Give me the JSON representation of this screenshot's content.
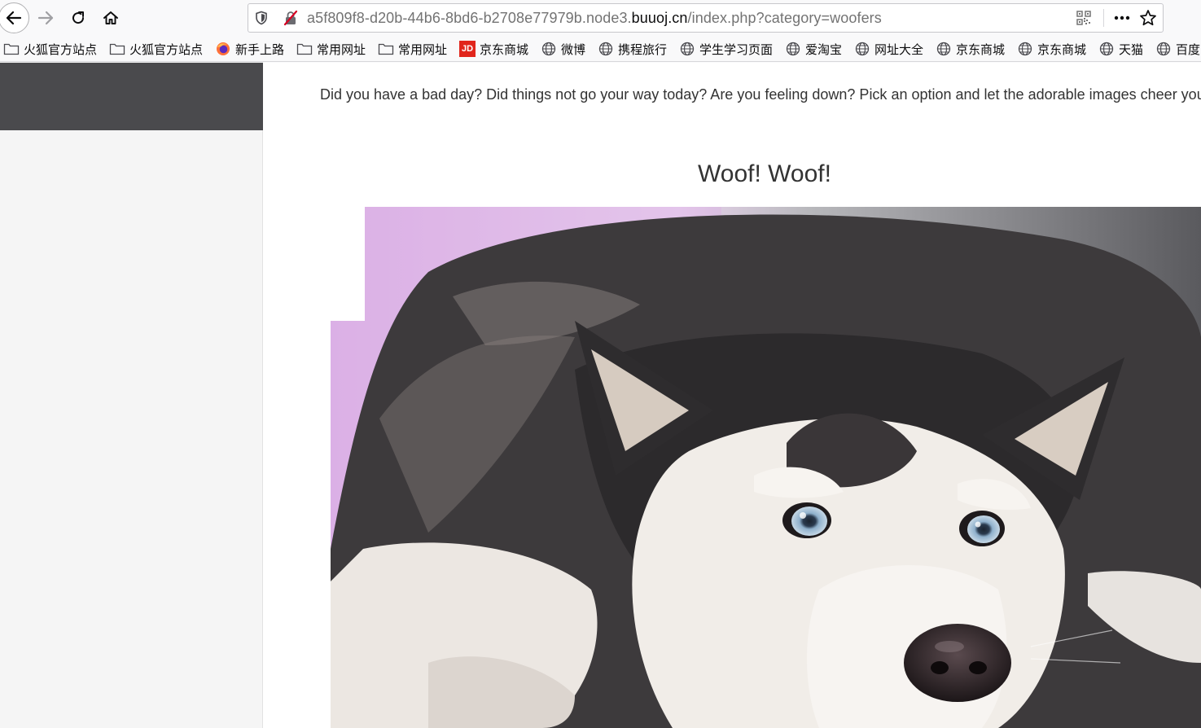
{
  "browser": {
    "url": {
      "prefix": "a5f809f8-d20b-44b6-8bd6-b2708e77979b.node3.",
      "domain": "buuoj.cn",
      "path": "/index.php?category=woofers"
    },
    "icons": [
      "back-icon",
      "forward-icon",
      "reload-icon",
      "home-icon",
      "shield-icon",
      "insecure-lock-icon",
      "qr-code-icon",
      "more-icon",
      "star-icon"
    ]
  },
  "bookmarks": [
    {
      "label": "火狐官方站点",
      "icon": "folder-icon"
    },
    {
      "label": "火狐官方站点",
      "icon": "folder-icon"
    },
    {
      "label": "新手上路",
      "icon": "firefox-icon"
    },
    {
      "label": "常用网址",
      "icon": "folder-icon"
    },
    {
      "label": "常用网址",
      "icon": "folder-icon"
    },
    {
      "label": "京东商城",
      "icon": "jd-icon",
      "icon_text": "JD"
    },
    {
      "label": "微博",
      "icon": "globe-icon"
    },
    {
      "label": "携程旅行",
      "icon": "globe-icon"
    },
    {
      "label": "学生学习页面",
      "icon": "globe-icon"
    },
    {
      "label": "爱淘宝",
      "icon": "globe-icon"
    },
    {
      "label": "网址大全",
      "icon": "globe-icon"
    },
    {
      "label": "京东商城",
      "icon": "globe-icon"
    },
    {
      "label": "京东商城",
      "icon": "globe-icon"
    },
    {
      "label": "天猫",
      "icon": "globe-icon"
    },
    {
      "label": "百度",
      "icon": "globe-icon"
    }
  ],
  "page": {
    "intro": "Did you have a bad day? Did things not go your way today? Are you feeling down? Pick an option and let the adorable images cheer you up!",
    "heading": "Woof! Woof!"
  },
  "colors": {
    "sidebar_header": "#4a4a4d",
    "sidebar": "#f5f5f5",
    "jd_red": "#e1251b"
  }
}
